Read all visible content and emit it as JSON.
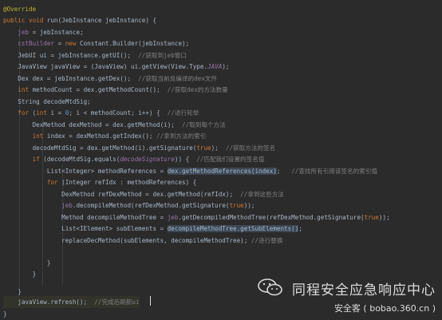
{
  "code": {
    "lines": [
      {
        "t": [
          [
            "ann",
            "@Override"
          ]
        ]
      },
      {
        "t": [
          [
            "kw",
            "public void "
          ],
          [
            "",
            "run(JebInstance jebInstance) {"
          ]
        ]
      },
      {
        "t": [
          [
            "",
            "    "
          ],
          [
            "fld",
            "jeb"
          ],
          [
            "",
            " = jebInstance;"
          ]
        ]
      },
      {
        "t": [
          [
            "",
            "    "
          ],
          [
            "fld",
            "cstBuilder"
          ],
          [
            "",
            " = "
          ],
          [
            "kw",
            "new "
          ],
          [
            "",
            "Constant.Builder(jebInstance);"
          ]
        ]
      },
      {
        "t": [
          [
            "",
            "    JebUI ui = jebInstance.getUI();  "
          ],
          [
            "cm",
            "//获取到jeb窗口"
          ]
        ]
      },
      {
        "t": [
          [
            "",
            "    JavaView javaView = (JavaView) ui.getView(View.Type."
          ],
          [
            "it",
            "JAVA"
          ],
          [
            "",
            ");"
          ]
        ]
      },
      {
        "t": [
          [
            "",
            "    Dex dex = jebInstance.getDex();  "
          ],
          [
            "cm",
            "//获取当前反编译的dex文件"
          ]
        ]
      },
      {
        "t": [
          [
            "",
            "    "
          ],
          [
            "kw",
            "int "
          ],
          [
            "",
            "methodCount = dex.getMethodCount();  "
          ],
          [
            "cm",
            "//获取dex的方法数量"
          ]
        ]
      },
      {
        "t": [
          [
            "",
            "    String decodeMtdSig;"
          ]
        ]
      },
      {
        "t": [
          [
            "",
            "    "
          ],
          [
            "kw",
            "for "
          ],
          [
            "",
            "("
          ],
          [
            "kw",
            "int "
          ],
          [
            "",
            "i = "
          ],
          [
            "num",
            "0"
          ],
          [
            "",
            "; i < methodCount; i++) {  "
          ],
          [
            "cm",
            "//进行轮举"
          ]
        ]
      },
      {
        "t": [
          [
            "",
            "        DexMethod dexMethod = dex.getMethod(i);  "
          ],
          [
            "cm",
            "//取到每个方法"
          ]
        ]
      },
      {
        "t": [
          [
            "",
            "        "
          ],
          [
            "kw",
            "int "
          ],
          [
            "",
            "index = dexMethod.getIndex(); "
          ],
          [
            "cm",
            "//拿到方法的索引"
          ]
        ]
      },
      {
        "t": [
          [
            "",
            "        decodeMtdSig = dex.getMethod(i).getSignature("
          ],
          [
            "kw",
            "true"
          ],
          [
            "",
            ");  "
          ],
          [
            "cm",
            "//获取方法的签名"
          ]
        ]
      },
      {
        "t": [
          [
            "",
            "        "
          ],
          [
            "kw",
            "if "
          ],
          [
            "",
            "(decodeMtdSig.equals("
          ],
          [
            "it",
            "decodeSignature"
          ],
          [
            "",
            ")) {  "
          ],
          [
            "cm",
            "//匹配我们设置的签名值"
          ]
        ]
      },
      {
        "t": [
          [
            "",
            "            List<Integer> methodReferences = "
          ],
          [
            "hl",
            "dex.getMethodReferences(index)"
          ],
          [
            "",
            ";   "
          ],
          [
            "cm",
            "//查找所有引用该签名的索引值"
          ]
        ]
      },
      {
        "t": [
          [
            "",
            "            "
          ],
          [
            "kw",
            "for "
          ],
          [
            "",
            "(Integer refIdx : methodReferences) {"
          ]
        ]
      },
      {
        "t": [
          [
            "",
            "                DexMethod refDexMethod = dex.getMethod(refIdx);  "
          ],
          [
            "cm",
            "//拿到这些方法"
          ]
        ]
      },
      {
        "t": [
          [
            "",
            "                "
          ],
          [
            "fld",
            "jeb"
          ],
          [
            "",
            ".decompileMethod(refDexMethod.getSignature("
          ],
          [
            "kw",
            "true"
          ],
          [
            "",
            "));"
          ]
        ]
      },
      {
        "t": [
          [
            "",
            "                Method decompileMethodTree = "
          ],
          [
            "fld",
            "jeb"
          ],
          [
            "",
            ".getDecompiledMethodTree(refDexMethod.getSignature("
          ],
          [
            "kw",
            "true"
          ],
          [
            "",
            "));"
          ]
        ]
      },
      {
        "t": [
          [
            "",
            "                List<IElement> subElements = "
          ],
          [
            "hl",
            "decompileMethodTree.getSubElements()"
          ],
          [
            "",
            ";"
          ]
        ]
      },
      {
        "t": [
          [
            "",
            "                replaceDecMethod(subElements, decompileMethodTree); "
          ],
          [
            "cm",
            "//进行替换"
          ]
        ]
      },
      {
        "t": [
          [
            "",
            ""
          ]
        ]
      },
      {
        "t": [
          [
            "",
            "            }"
          ]
        ]
      },
      {
        "t": [
          [
            "",
            "        }"
          ]
        ]
      },
      {
        "t": [
          [
            "",
            ""
          ]
        ]
      },
      {
        "t": [
          [
            "",
            "    }"
          ]
        ]
      },
      {
        "t": [
          [
            "",
            "    javaView.refresh();  "
          ],
          [
            "cm",
            "//完成后刷新ui"
          ]
        ]
      },
      {
        "t": [
          [
            "",
            "}"
          ]
        ]
      }
    ],
    "line_tops": [
      4,
      18,
      33,
      47,
      62,
      76,
      91,
      105,
      120,
      134,
      149,
      163,
      178,
      192,
      207,
      221,
      236,
      250,
      265,
      279,
      294,
      308,
      322,
      336,
      350,
      358,
      371,
      386
    ]
  },
  "watermark": {
    "org": "同程安全应急响应中心",
    "site": "安全客 ( bobao.360.cn )",
    "icon": "wechat-icon"
  },
  "colors": {
    "background": "#2b2b2b",
    "keyword": "#cc7832",
    "comment": "#808080",
    "annotation": "#bbb529",
    "field": "#9876aa",
    "number": "#6897bb",
    "text": "#a9b7c6"
  }
}
